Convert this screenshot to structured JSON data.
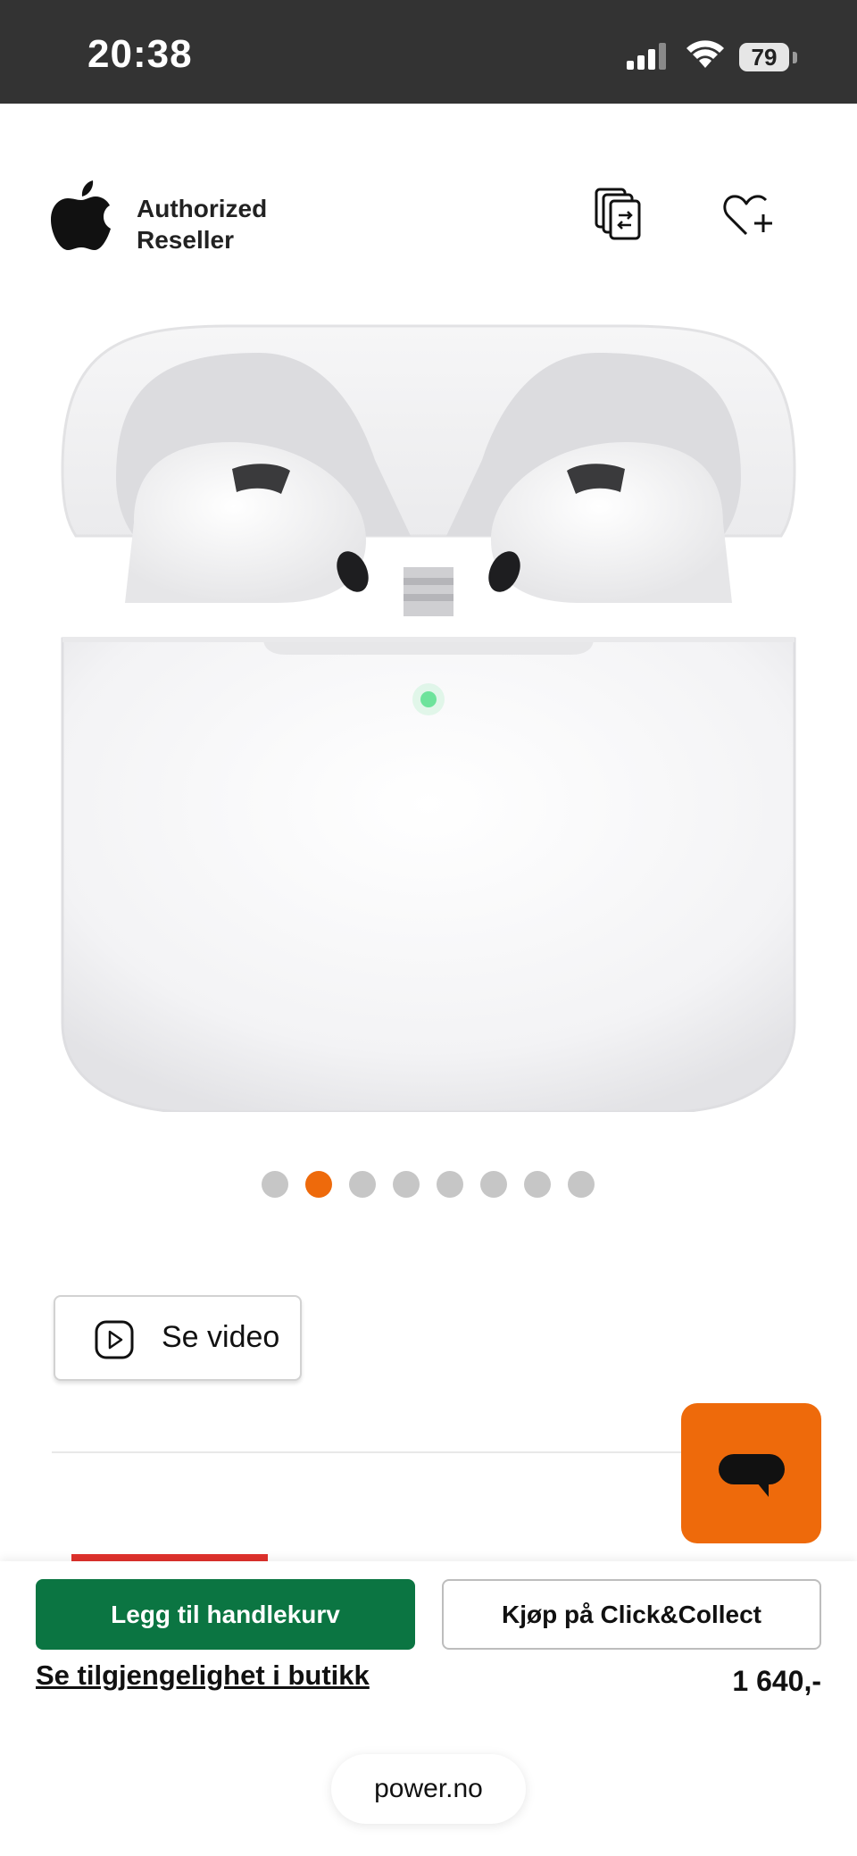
{
  "status_bar": {
    "time": "20:38",
    "battery": "79",
    "icons": [
      "cellular-signal-icon",
      "wifi-icon",
      "battery-icon"
    ]
  },
  "header": {
    "reseller_line1": "Authorized",
    "reseller_line2": "Reseller",
    "icons": [
      "apple-logo",
      "compare-icon",
      "heart-plus-icon"
    ]
  },
  "gallery": {
    "dot_count": 8,
    "active_index": 1
  },
  "video_button": {
    "label": "Se video",
    "icon": "play-icon"
  },
  "chat": {
    "icon": "chat-bubble-icon"
  },
  "actions": {
    "add_to_cart": "Legg til handlekurv",
    "click_collect": "Kjøp på Click&Collect",
    "availability": "Se tilgjengelighet i butikk",
    "price": "1 640,-"
  },
  "browser": {
    "url": "power.no"
  },
  "colors": {
    "accent_orange": "#ee6a0b",
    "cart_green": "#0b7542",
    "status_bar": "#333333",
    "dot_inactive": "#c6c6c6",
    "sale_red": "#e0322d"
  }
}
